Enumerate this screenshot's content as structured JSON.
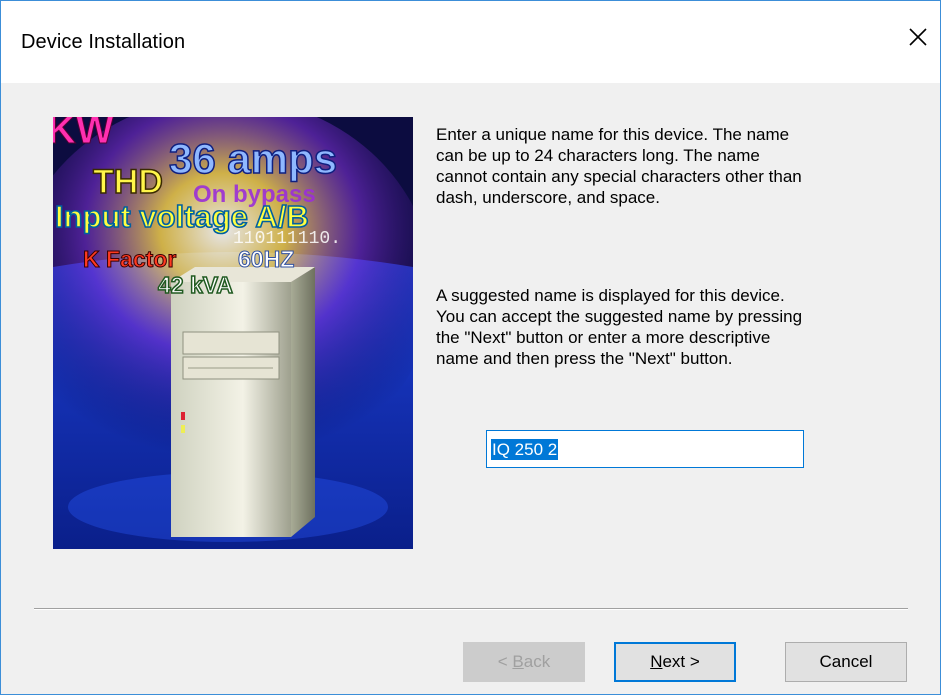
{
  "window": {
    "title": "Device Installation",
    "close_glyph": "✕"
  },
  "artwork": {
    "labels": {
      "kw": "KW",
      "amps": "36 amps",
      "thd": "THD",
      "bypass": "On bypass",
      "input_voltage": "Input voltage A/B",
      "binary": "110111110.",
      "kfactor": "K Factor",
      "hz": "60HZ",
      "kva": "42 kVA"
    }
  },
  "instructions": {
    "paragraph1": "Enter a unique name for this device. The name\ncan be up to 24 characters long. The name\ncannot contain any special characters other than\ndash, underscore, and space.",
    "paragraph2": "A suggested name is displayed for this device.\nYou can accept the suggested name by pressing\nthe \"Next\" button or enter a more descriptive\nname and then press the \"Next\" button."
  },
  "device_name": {
    "value": "IQ 250 2"
  },
  "buttons": {
    "back_mnemonic": "B",
    "back_rest": "ack",
    "back_prefix": "< ",
    "next_mnemonic": "N",
    "next_rest": "ext >",
    "cancel": "Cancel"
  },
  "colors": {
    "accent": "#0078d7",
    "window_border": "#3c8ed8",
    "dialog_bg": "#f0f0f0"
  }
}
